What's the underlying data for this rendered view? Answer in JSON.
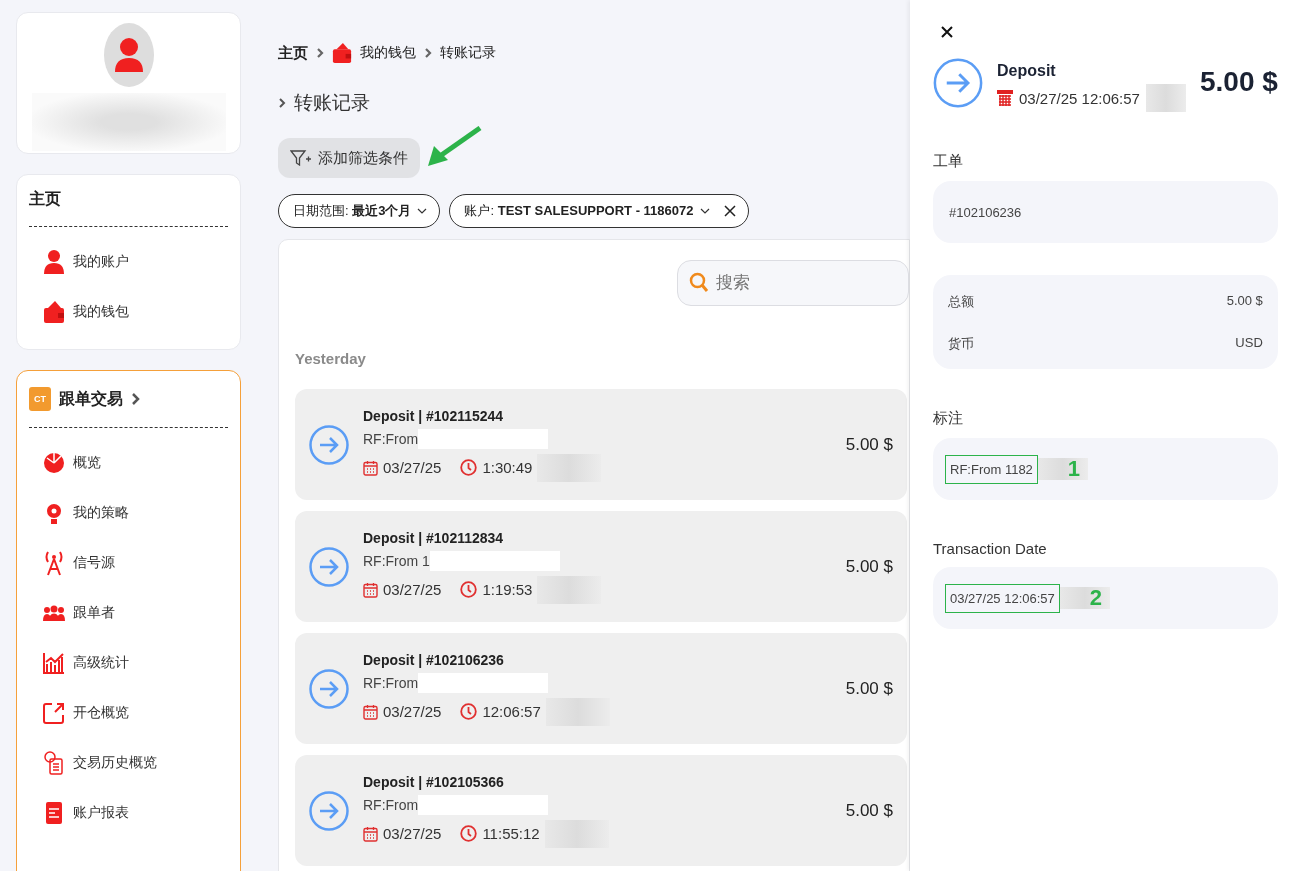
{
  "sidebar": {
    "home_card": {
      "heading": "主页",
      "items": [
        {
          "label": "我的账户"
        },
        {
          "label": "我的钱包"
        }
      ]
    },
    "copy_trading": {
      "logo": "CT",
      "heading": "跟单交易",
      "items": [
        {
          "label": "概览"
        },
        {
          "label": "我的策略"
        },
        {
          "label": "信号源"
        },
        {
          "label": "跟单者"
        },
        {
          "label": "高级统计"
        },
        {
          "label": "开仓概览"
        },
        {
          "label": "交易历史概览"
        },
        {
          "label": "账户报表"
        }
      ]
    }
  },
  "breadcrumb": [
    {
      "label": "主页"
    },
    {
      "label": "我的钱包"
    },
    {
      "label": "转账记录"
    }
  ],
  "page_title": "转账记录",
  "add_filter_button": "添加筛选条件",
  "filters": [
    {
      "label": "日期范围:",
      "value": "最近3个月",
      "removable": false
    },
    {
      "label": "账户:",
      "value": "TEST SALESUPPORT - 1186072",
      "removable": true
    }
  ],
  "search": {
    "placeholder": "搜索"
  },
  "group_label": "Yesterday",
  "transactions": [
    {
      "title": "Deposit | #102115244",
      "note": "RF:From",
      "date": "03/27/25",
      "time": "1:30:49",
      "amount": "5.00 $"
    },
    {
      "title": "Deposit | #102112834",
      "note": "RF:From 1",
      "date": "03/27/25",
      "time": "1:19:53",
      "amount": "5.00 $"
    },
    {
      "title": "Deposit | #102106236",
      "note": "RF:From",
      "date": "03/27/25",
      "time": "12:06:57",
      "amount": "5.00 $"
    },
    {
      "title": "Deposit | #102105366",
      "note": "RF:From",
      "date": "03/27/25",
      "time": "11:55:12",
      "amount": "5.00 $"
    }
  ],
  "detail": {
    "title": "Deposit",
    "datetime": "03/27/25 12:06:57",
    "amount": "5.00 $",
    "ticket": {
      "label": "工单",
      "value": "#102106236"
    },
    "summary": [
      {
        "label": "总额",
        "value": "5.00 $"
      },
      {
        "label": "货币",
        "value": "USD"
      }
    ],
    "note": {
      "label": "标注",
      "value": "RF:From 1182",
      "marker": "1"
    },
    "date": {
      "label": "Transaction Date",
      "value": "03/27/25 12:06:57",
      "marker": "2"
    }
  }
}
